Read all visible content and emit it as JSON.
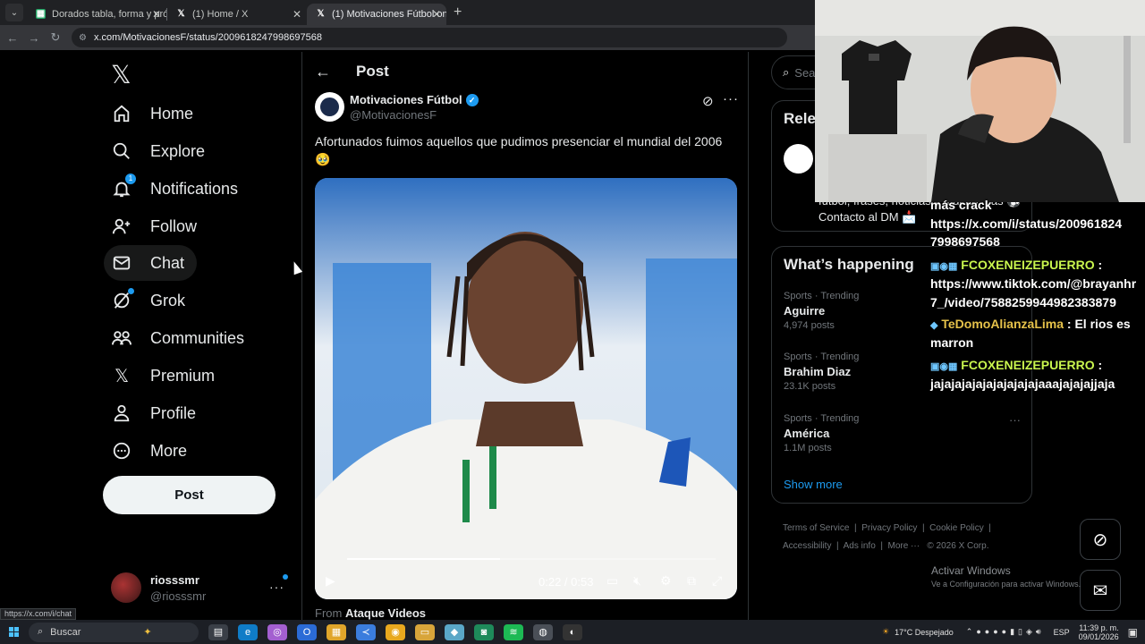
{
  "browser": {
    "tabs": [
      {
        "title": "Dorados tabla, forma y próxim",
        "favicon_color": "#1ea362"
      },
      {
        "title": "(1) Home / X",
        "favicon_color": "#ffffff"
      },
      {
        "title": "(1) Motivaciones Fútbol on X: '",
        "favicon_color": "#ffffff"
      }
    ],
    "url": "x.com/MotivacionesF/status/2009618247998697568",
    "status_url": "https://x.com/i/chat"
  },
  "sidebar": {
    "items": [
      {
        "label": "Home",
        "icon": "home-icon"
      },
      {
        "label": "Explore",
        "icon": "search-icon"
      },
      {
        "label": "Notifications",
        "icon": "bell-icon",
        "badge": "1"
      },
      {
        "label": "Follow",
        "icon": "add-person-icon"
      },
      {
        "label": "Chat",
        "icon": "mail-icon"
      },
      {
        "label": "Grok",
        "icon": "grok-icon"
      },
      {
        "label": "Communities",
        "icon": "people-icon"
      },
      {
        "label": "Premium",
        "icon": "x-icon"
      },
      {
        "label": "Profile",
        "icon": "person-icon"
      },
      {
        "label": "More",
        "icon": "more-circle-icon"
      }
    ],
    "post_button": "Post",
    "account": {
      "name": "riosssmr",
      "handle": "@riosssmr"
    }
  },
  "post": {
    "header": "Post",
    "author_name": "Motivaciones Fútbol",
    "author_handle": "@MotivacionesF",
    "text": "Afortunados fuimos aquellos que pudimos presenciar el mundial del 2006 🥹",
    "video": {
      "current_time": "0:22",
      "duration": "0:53",
      "progress": 0.415
    },
    "from_label": "From",
    "from_source": "Ataque Videos"
  },
  "right": {
    "search_placeholder": "Sea",
    "relevant_title": "Rele",
    "relevant_bio": "fútbol, frases, noticias y mucho más ⚽ Contacto al DM 📩",
    "happening_title": "What’s happening",
    "trends": [
      {
        "category": "Sports · Trending",
        "name": "Aguirre",
        "posts": "4,974 posts"
      },
      {
        "category": "Sports · Trending",
        "name": "Brahim Diaz",
        "posts": "23.1K posts"
      },
      {
        "category": "Sports · Trending",
        "name": "América",
        "posts": "1.1M posts"
      }
    ],
    "show_more": "Show more",
    "footer": {
      "terms": "Terms of Service",
      "privacy": "Privacy Policy",
      "cookie": "Cookie Policy",
      "accessibility": "Accessibility",
      "ads": "Ads info",
      "more": "More ···",
      "copyright": "© 2026 X Corp."
    }
  },
  "chat_overlay": {
    "lines": [
      {
        "text": "más crack"
      },
      {
        "text": "https://x.com/i/status/200961824"
      },
      {
        "text": "7998697568"
      },
      {
        "user": "FCOXENEIZEPUERRO",
        "text": " :"
      },
      {
        "text": "https://www.tiktok.com/@brayanhr"
      },
      {
        "text": "7_/video/7588259944982383879"
      },
      {
        "user": "TeDomoAlianzaLima",
        "text": " : El rios es"
      },
      {
        "text": "marron"
      },
      {
        "user": "FCOXENEIZEPUERRO",
        "text": " :"
      },
      {
        "text": "jajajajajajajajajajajaaajajajajjaja"
      }
    ]
  },
  "windows": {
    "activate_title": "Activar Windows",
    "activate_sub": "Ve a Configuración para activar Windows.",
    "search": "Buscar",
    "weather": "17°C  Despejado",
    "lang": "ESP",
    "time": "11:39 p. m.",
    "date": "09/01/2026"
  }
}
